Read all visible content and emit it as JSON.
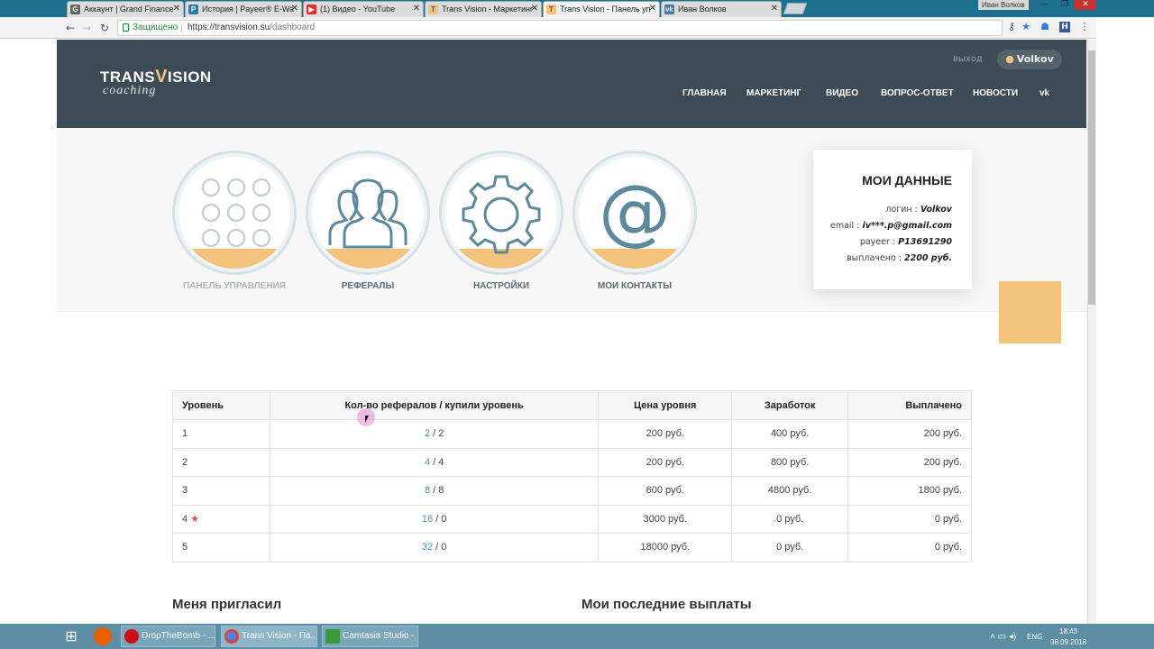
{
  "browser": {
    "tabs": [
      {
        "title": "Аккаунт | Grand Finance",
        "color": "#666"
      },
      {
        "title": "История | Payeer® E-Wa",
        "color": "#2a7ab0"
      },
      {
        "title": "(1) Видео - YouTube",
        "color": "#e52d27"
      },
      {
        "title": "Trans Vision - Маркетинг",
        "color": "#f3c37d"
      },
      {
        "title": "Trans Vision - Панель уп",
        "color": "#f3c37d"
      },
      {
        "title": "Иван Волков",
        "color": "#4a76a8"
      }
    ],
    "profile_name": "Иван Волков",
    "security_label": "Защищено",
    "url_host": "https://transvision.su",
    "url_path": "/dashboard"
  },
  "site": {
    "logo_main_a": "TRANS",
    "logo_main_v": "V",
    "logo_main_b": "ISION",
    "logo_sub": "coaching",
    "exit_label": "выход",
    "username": "Volkov",
    "nav": [
      "ГЛАВНАЯ",
      "МАРКЕТИНГ",
      "ВИДЕО",
      "ВОПРОС-ОТВЕТ",
      "НОВОСТИ",
      "vk"
    ]
  },
  "dashboard": {
    "tiles": [
      {
        "label": "ПАНЕЛЬ УПРАВЛЕНИЯ",
        "icon": "grid-icon"
      },
      {
        "label": "РЕФЕРАЛЫ",
        "icon": "users-icon"
      },
      {
        "label": "НАСТРОЙКИ",
        "icon": "gear-icon"
      },
      {
        "label": "МОИ КОНТАКТЫ",
        "icon": "at-icon"
      }
    ],
    "my_data": {
      "title": "МОИ ДАННЫЕ",
      "login_label": "логин :",
      "login": "Volkov",
      "email_label": "email :",
      "email": "iv***.p@gmail.com",
      "payeer_label": "payeer :",
      "payeer": "P13691290",
      "paid_label": "выплачено :",
      "paid": "2200 руб."
    }
  },
  "levels_table": {
    "headers": [
      "Уровень",
      "Кол-во рефералов / купили уровень",
      "Цена уровня",
      "Заработок",
      "Выплачено"
    ],
    "rows": [
      {
        "level": "1",
        "star": false,
        "refs": "2",
        "bought": "2",
        "price": "200 руб.",
        "earned": "400 руб.",
        "paid": "200 руб."
      },
      {
        "level": "2",
        "star": false,
        "refs": "4",
        "bought": "4",
        "price": "200 руб.",
        "earned": "800 руб.",
        "paid": "200 руб."
      },
      {
        "level": "3",
        "star": false,
        "refs": "8",
        "bought": "8",
        "price": "600 руб.",
        "earned": "4800 руб.",
        "paid": "1800 руб."
      },
      {
        "level": "4",
        "star": true,
        "refs": "16",
        "bought": "0",
        "price": "3000 руб.",
        "earned": "0 руб.",
        "paid": "0 руб."
      },
      {
        "level": "5",
        "star": false,
        "refs": "32",
        "bought": "0",
        "price": "18000 руб.",
        "earned": "0 руб.",
        "paid": "0 руб."
      }
    ]
  },
  "sections": {
    "invited_by": "Меня пригласил",
    "last_payouts": "Мои последние выплаты"
  },
  "taskbar": {
    "tasks": [
      "DropTheBomb - ...",
      "Trans Vision - Па...",
      "Camtasia Studio - ..."
    ],
    "lang": "ENG",
    "time": "18:43",
    "date": "08.09.2018"
  }
}
